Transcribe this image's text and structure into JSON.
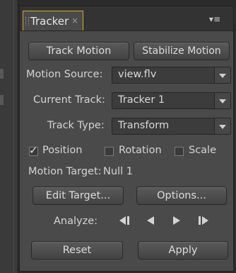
{
  "panel": {
    "tab_label": "Tracker",
    "tab_close": "×",
    "menu_icon": "▾≡"
  },
  "buttons": {
    "track_motion": "Track Motion",
    "stabilize_motion": "Stabilize Motion",
    "edit_target": "Edit Target...",
    "options": "Options...",
    "reset": "Reset",
    "apply": "Apply"
  },
  "motion_source": {
    "label": "Motion Source:",
    "value": "view.flv"
  },
  "current_track": {
    "label": "Current Track:",
    "value": "Tracker 1"
  },
  "track_type": {
    "label": "Track Type:",
    "value": "Transform"
  },
  "checkboxes": {
    "position": {
      "label": "Position",
      "checked": true,
      "check_glyph": "✓"
    },
    "rotation": {
      "label": "Rotation",
      "checked": false
    },
    "scale": {
      "label": "Scale",
      "checked": false
    }
  },
  "motion_target": {
    "label": "Motion Target:",
    "value": "Null 1"
  },
  "analyze": {
    "label": "Analyze:",
    "icons": [
      "analyze-1-frame-backward-icon",
      "analyze-backward-icon",
      "analyze-forward-icon",
      "analyze-1-frame-forward-icon"
    ]
  },
  "colors": {
    "panel_bg": "#4a4a4a",
    "tab_accent": "#d7a928",
    "text": "#d4d4d4"
  }
}
